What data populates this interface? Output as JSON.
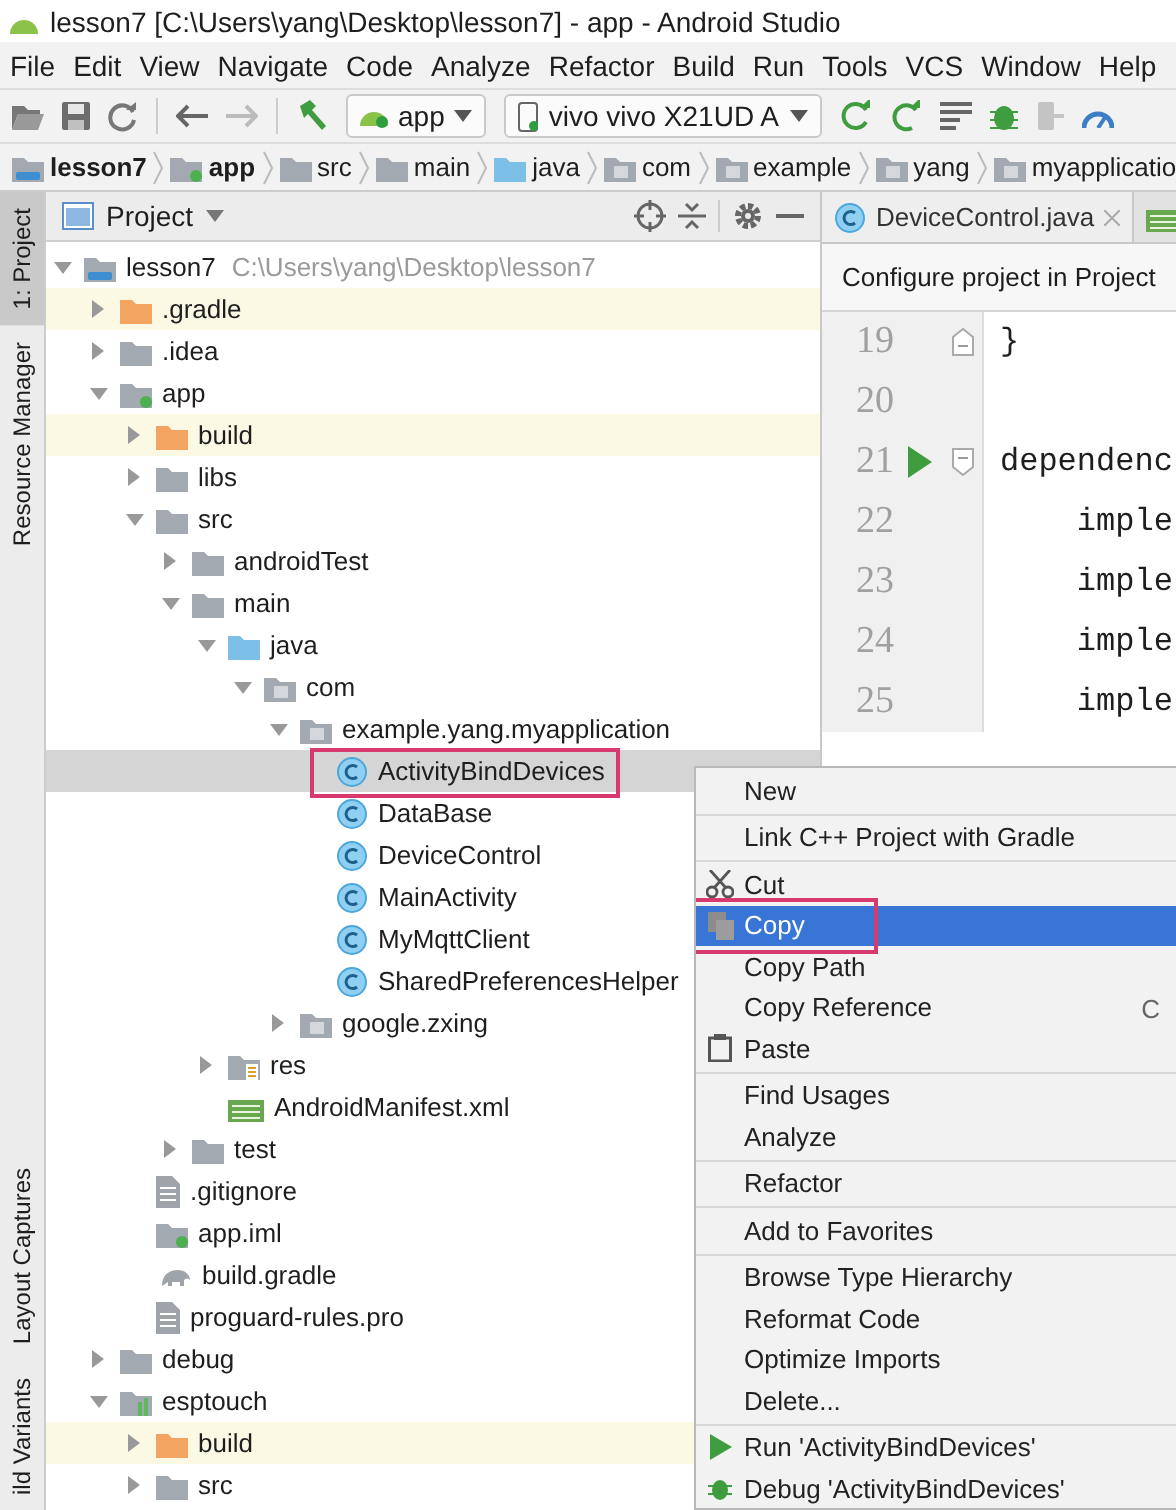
{
  "window": {
    "title": "lesson7 [C:\\Users\\yang\\Desktop\\lesson7] - app - Android Studio"
  },
  "menu_bar": [
    "File",
    "Edit",
    "View",
    "Navigate",
    "Code",
    "Analyze",
    "Refactor",
    "Build",
    "Run",
    "Tools",
    "VCS",
    "Window",
    "Help"
  ],
  "toolbar": {
    "run_config": "app",
    "device": "vivo vivo X21UD A"
  },
  "breadcrumbs": [
    {
      "label": "lesson7",
      "kind": "project"
    },
    {
      "label": "app",
      "kind": "module"
    },
    {
      "label": "src",
      "kind": "folder"
    },
    {
      "label": "main",
      "kind": "folder"
    },
    {
      "label": "java",
      "kind": "source-folder"
    },
    {
      "label": "com",
      "kind": "package"
    },
    {
      "label": "example",
      "kind": "package"
    },
    {
      "label": "yang",
      "kind": "package"
    },
    {
      "label": "myapplicatio",
      "kind": "package"
    }
  ],
  "side_strip": {
    "top_tabs": [
      {
        "label": "1: Project",
        "selected": true
      },
      {
        "label": "Resource Manager",
        "selected": false
      }
    ],
    "bottom_tabs": [
      {
        "label": "Layout Captures",
        "selected": false
      },
      {
        "label": "ild Variants",
        "selected": false
      }
    ]
  },
  "project_panel": {
    "title": "Project",
    "tree": [
      {
        "label": "lesson7",
        "path": "C:\\Users\\yang\\Desktop\\lesson7",
        "kind": "project",
        "expanded": true,
        "selected": false,
        "children": [
          {
            "label": ".gradle",
            "kind": "excluded-folder",
            "expanded": false,
            "selected": false
          },
          {
            "label": ".idea",
            "kind": "folder",
            "expanded": false,
            "selected": false
          },
          {
            "label": "app",
            "kind": "module",
            "expanded": true,
            "selected": false,
            "children": [
              {
                "label": "build",
                "kind": "excluded-folder",
                "expanded": false,
                "selected": false
              },
              {
                "label": "libs",
                "kind": "folder",
                "expanded": false,
                "selected": false
              },
              {
                "label": "src",
                "kind": "folder",
                "expanded": true,
                "selected": false,
                "children": [
                  {
                    "label": "androidTest",
                    "kind": "folder",
                    "expanded": false,
                    "selected": false
                  },
                  {
                    "label": "main",
                    "kind": "folder",
                    "expanded": true,
                    "selected": false,
                    "children": [
                      {
                        "label": "java",
                        "kind": "source-folder",
                        "expanded": true,
                        "selected": false,
                        "children": [
                          {
                            "label": "com",
                            "kind": "package",
                            "expanded": true,
                            "selected": false,
                            "children": [
                              {
                                "label": "example.yang.myapplication",
                                "kind": "package",
                                "expanded": true,
                                "selected": false,
                                "children": [
                                  {
                                    "label": "ActivityBindDevices",
                                    "kind": "class",
                                    "selected": true,
                                    "annotated": true
                                  },
                                  {
                                    "label": "DataBase",
                                    "kind": "class",
                                    "selected": false,
                                    "annotated": false
                                  },
                                  {
                                    "label": "DeviceControl",
                                    "kind": "class",
                                    "selected": false,
                                    "annotated": false
                                  },
                                  {
                                    "label": "MainActivity",
                                    "kind": "class",
                                    "selected": false,
                                    "annotated": false
                                  },
                                  {
                                    "label": "MyMqttClient",
                                    "kind": "class",
                                    "selected": false,
                                    "annotated": false
                                  },
                                  {
                                    "label": "SharedPreferencesHelper",
                                    "kind": "class",
                                    "selected": false,
                                    "annotated": false
                                  }
                                ]
                              },
                              {
                                "label": "google.zxing",
                                "kind": "package",
                                "expanded": false,
                                "selected": false
                              }
                            ]
                          }
                        ]
                      },
                      {
                        "label": "res",
                        "kind": "resource-folder",
                        "expanded": false,
                        "selected": false
                      },
                      {
                        "label": "AndroidManifest.xml",
                        "kind": "manifest",
                        "selected": false
                      }
                    ]
                  },
                  {
                    "label": "test",
                    "kind": "folder",
                    "expanded": false,
                    "selected": false
                  }
                ]
              },
              {
                "label": ".gitignore",
                "kind": "text-file",
                "selected": false
              },
              {
                "label": "app.iml",
                "kind": "module-file",
                "selected": false
              },
              {
                "label": "build.gradle",
                "kind": "gradle-file",
                "selected": false
              },
              {
                "label": "proguard-rules.pro",
                "kind": "text-file",
                "selected": false
              }
            ]
          },
          {
            "label": "debug",
            "kind": "folder",
            "expanded": false,
            "selected": false
          },
          {
            "label": "esptouch",
            "kind": "library-module",
            "expanded": true,
            "selected": false,
            "children": [
              {
                "label": "build",
                "kind": "excluded-folder",
                "expanded": false,
                "selected": false
              },
              {
                "label": "src",
                "kind": "folder",
                "expanded": false,
                "selected": false
              }
            ]
          }
        ]
      }
    ]
  },
  "editor": {
    "tabs": [
      {
        "label": "DeviceControl.java",
        "kind": "class",
        "selected": true
      },
      {
        "kind": "manifest",
        "selected": false
      }
    ],
    "banner": "Configure project in Project",
    "lines": [
      {
        "number": "19",
        "text": "}",
        "kind": "fold-end",
        "runnable": false
      },
      {
        "number": "20",
        "kind": "plain",
        "runnable": false
      },
      {
        "number": "21",
        "text": "dependenc",
        "kind": "fold-start",
        "runnable": true
      },
      {
        "number": "22",
        "text": "    imple",
        "kind": "plain",
        "runnable": false
      },
      {
        "number": "23",
        "text": "    imple",
        "kind": "plain",
        "runnable": false
      },
      {
        "number": "24",
        "text": "    imple",
        "kind": "plain",
        "runnable": false
      },
      {
        "number": "25",
        "text": "    imple",
        "kind": "plain",
        "runnable": false
      }
    ]
  },
  "context_menu": {
    "groups": [
      [
        {
          "label": "New",
          "kind": "plain",
          "selected": false
        }
      ],
      [
        {
          "label": "Link C++ Project with Gradle",
          "kind": "plain",
          "selected": false
        }
      ],
      [
        {
          "label": "Cut",
          "kind": "cut",
          "selected": false
        },
        {
          "label": "Copy",
          "kind": "copy",
          "selected": true,
          "annotated": true
        },
        {
          "label": "Copy Path",
          "kind": "plain",
          "selected": false
        },
        {
          "label": "Copy Reference",
          "kind": "plain",
          "shortcut": "C",
          "selected": false
        },
        {
          "label": "Paste",
          "kind": "paste",
          "selected": false
        }
      ],
      [
        {
          "label": "Find Usages",
          "kind": "plain",
          "selected": false
        },
        {
          "label": "Analyze",
          "kind": "plain",
          "selected": false
        }
      ],
      [
        {
          "label": "Refactor",
          "kind": "plain",
          "selected": false
        }
      ],
      [
        {
          "label": "Add to Favorites",
          "kind": "plain",
          "selected": false
        }
      ],
      [
        {
          "label": "Browse Type Hierarchy",
          "kind": "plain",
          "selected": false
        },
        {
          "label": "Reformat Code",
          "kind": "plain",
          "selected": false
        },
        {
          "label": "Optimize Imports",
          "kind": "plain",
          "selected": false
        },
        {
          "label": "Delete...",
          "kind": "plain",
          "selected": false
        }
      ],
      [
        {
          "label": "Run 'ActivityBindDevices'",
          "kind": "run",
          "selected": false
        },
        {
          "label": "Debug 'ActivityBindDevices'",
          "kind": "debug",
          "selected": false
        }
      ]
    ]
  }
}
